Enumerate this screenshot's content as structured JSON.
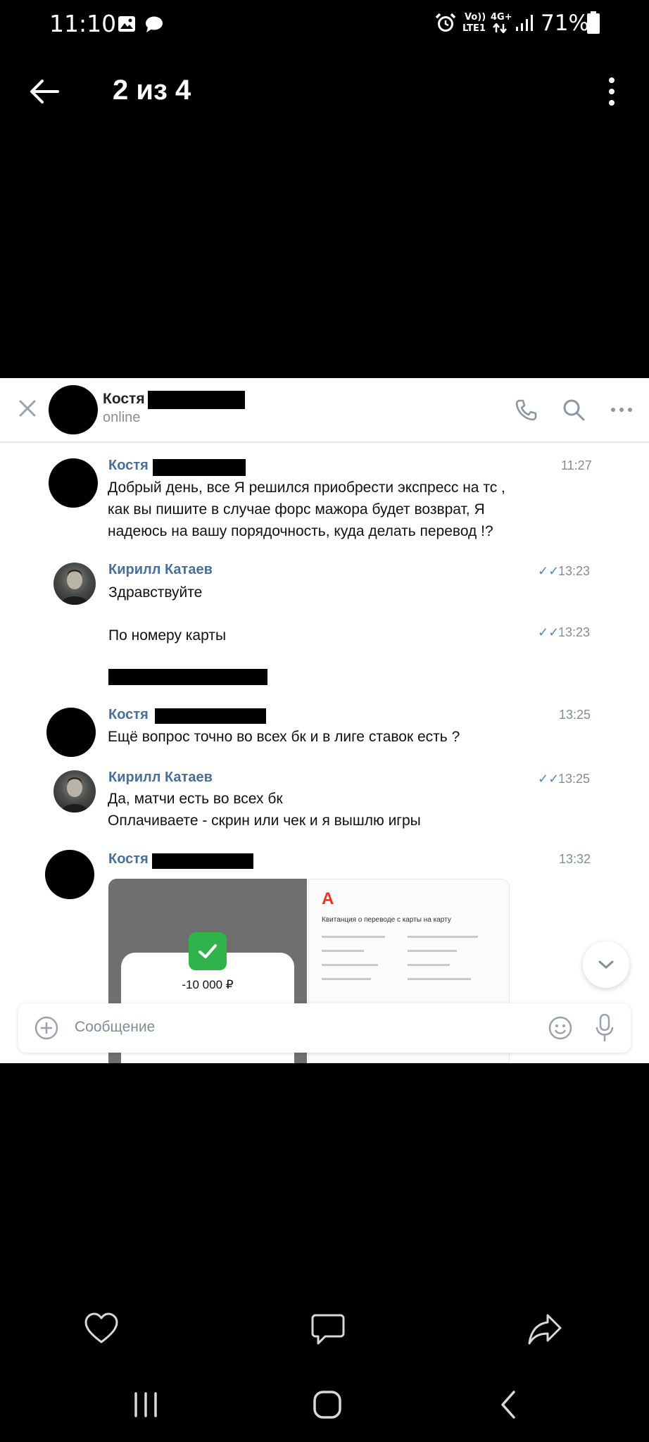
{
  "status_bar": {
    "time": "11:10",
    "battery": "71%",
    "network_top": "Vo))",
    "network_bottom": "LTE1",
    "data_type": "4G+"
  },
  "viewer": {
    "counter": "2 из 4"
  },
  "chat": {
    "contact_name": "Костя",
    "contact_status": "online",
    "messages": [
      {
        "sender": "Костя",
        "time": "11:27",
        "text": "Добрый день,  все Я решился приобрести экспресс на тс ,\nкак вы пишите в случае форс мажора будет возврат, Я\nнадеюсь на вашу порядочность,  куда делать перевод !?"
      },
      {
        "sender": "Кирилл Катаев",
        "time": "13:23",
        "text": "Здравствуйте"
      },
      {
        "sender": "",
        "time": "13:23",
        "text": "По номеру карты"
      },
      {
        "sender": "Костя",
        "time": "13:25",
        "text": "Ещё вопрос точно во всех бк и в лиге ставок есть ?"
      },
      {
        "sender": "Кирилл Катаев",
        "time": "13:25",
        "text": "Да, матчи есть во всех бк\nОплачиваете - скрин или чек и я вышлю игры"
      },
      {
        "sender": "Костя",
        "time": "13:32",
        "text": ""
      }
    ],
    "attachment": {
      "amount": "-10 000 ₽",
      "receipt_logo": "А",
      "receipt_title": "Квитанция о переводе с карты на карту"
    },
    "composer_placeholder": "Сообщение"
  },
  "icons": {
    "back": "arrow-left-icon",
    "more": "kebab-menu-icon",
    "favorite": "heart-icon",
    "comment": "speech-bubble-icon",
    "share": "share-arrow-icon",
    "nav_recents": "recents-icon",
    "nav_home": "home-icon",
    "nav_back": "nav-back-icon"
  },
  "colors": {
    "link_name": "#4a6f96",
    "read_ticks": "#5a86b4",
    "success_green": "#2fb34a",
    "bank_red": "#ef3124"
  }
}
